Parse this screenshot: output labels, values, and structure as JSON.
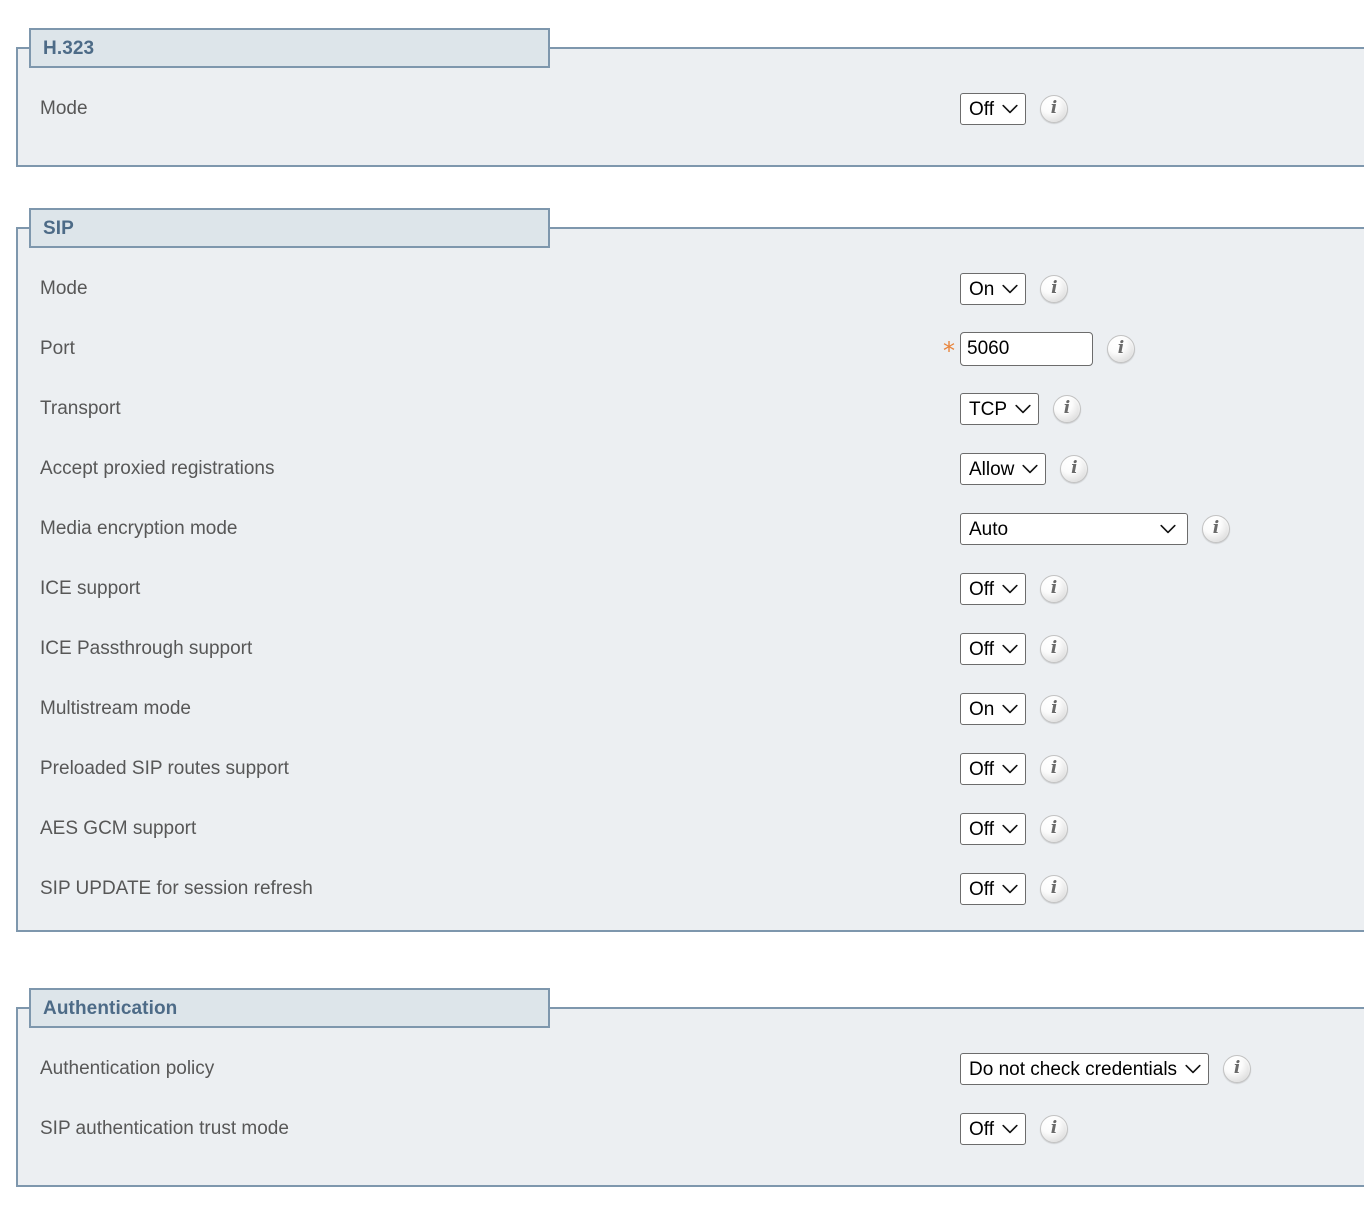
{
  "colors": {
    "section_border": "#7e97ad",
    "legend_bg": "#dde5ea",
    "legend_text": "#4d6b87",
    "body_bg": "#eceff2",
    "label_text": "#575757",
    "required_marker": "#e8833a"
  },
  "sections": [
    {
      "title": "H.323",
      "rows": [
        {
          "label": "Mode",
          "control": {
            "kind": "select",
            "value": "Off",
            "width": "auto"
          },
          "required": false,
          "info": "i"
        }
      ]
    },
    {
      "title": "SIP",
      "rows": [
        {
          "label": "Mode",
          "control": {
            "kind": "select",
            "value": "On",
            "width": "auto"
          },
          "required": false,
          "info": "i"
        },
        {
          "label": "Port",
          "control": {
            "kind": "text",
            "value": "5060",
            "placeholder": ""
          },
          "required": true,
          "required_marker": "*",
          "info": "i"
        },
        {
          "label": "Transport",
          "control": {
            "kind": "select",
            "value": "TCP",
            "width": "auto"
          },
          "required": false,
          "info": "i"
        },
        {
          "label": "Accept proxied registrations",
          "control": {
            "kind": "select",
            "value": "Allow",
            "width": "auto"
          },
          "required": false,
          "info": "i"
        },
        {
          "label": "Media encryption mode",
          "control": {
            "kind": "select",
            "value": "Auto",
            "width": "wide"
          },
          "required": false,
          "info": "i"
        },
        {
          "label": "ICE support",
          "control": {
            "kind": "select",
            "value": "Off",
            "width": "auto"
          },
          "required": false,
          "info": "i"
        },
        {
          "label": "ICE Passthrough support",
          "control": {
            "kind": "select",
            "value": "Off",
            "width": "auto"
          },
          "required": false,
          "info": "i"
        },
        {
          "label": "Multistream mode",
          "control": {
            "kind": "select",
            "value": "On",
            "width": "auto"
          },
          "required": false,
          "info": "i"
        },
        {
          "label": "Preloaded SIP routes support",
          "control": {
            "kind": "select",
            "value": "Off",
            "width": "auto"
          },
          "required": false,
          "info": "i"
        },
        {
          "label": "AES GCM support",
          "control": {
            "kind": "select",
            "value": "Off",
            "width": "auto"
          },
          "required": false,
          "info": "i"
        },
        {
          "label": "SIP UPDATE for session refresh",
          "control": {
            "kind": "select",
            "value": "Off",
            "width": "auto"
          },
          "required": false,
          "info": "i"
        }
      ]
    },
    {
      "title": "Authentication",
      "rows": [
        {
          "label": "Authentication policy",
          "control": {
            "kind": "select",
            "value": "Do not check credentials",
            "width": "auto"
          },
          "required": false,
          "info": "i"
        },
        {
          "label": "SIP authentication trust mode",
          "control": {
            "kind": "select",
            "value": "Off",
            "width": "auto"
          },
          "required": false,
          "info": "i"
        }
      ]
    }
  ]
}
